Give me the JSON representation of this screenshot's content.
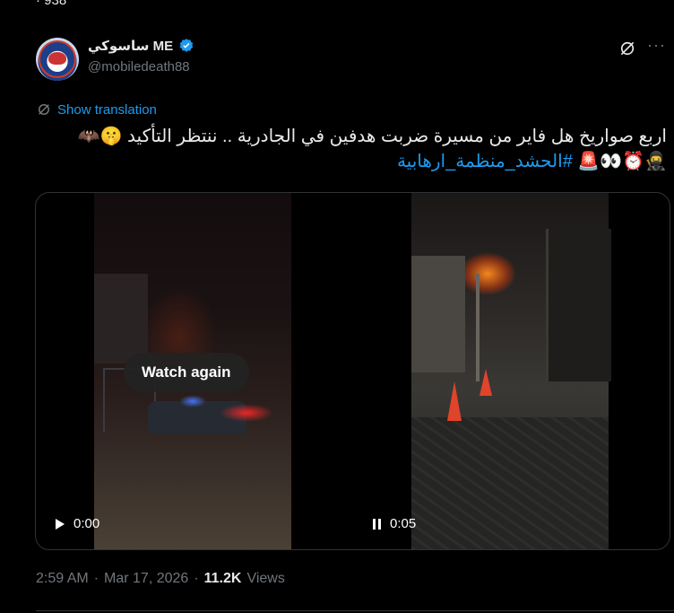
{
  "top_cut_text": "· 938",
  "tweet": {
    "author_name": "ساسوكي ME",
    "author_handle": "@mobiledeath88",
    "show_translation": "Show translation",
    "text_line1": "اربع صواريخ هل فاير من مسيرة ضربت هدفين في الجادرية .. ننتظر التأكيد 🤫🦇",
    "text_line2_emojis": "🥷⏰👀🚨",
    "hashtag": "#الحشد_منظمة_ارهابية",
    "more_label": "···"
  },
  "media": {
    "watch_again_label": "Watch again",
    "video1_time": "0:00",
    "video2_time": "0:05"
  },
  "meta": {
    "time": "2:59 AM",
    "sep1": "·",
    "date": "Mar 17, 2026",
    "sep2": "·",
    "views_count": "11.2K",
    "views_label": "Views"
  },
  "colors": {
    "background": "#000000",
    "text": "#e7e9ea",
    "muted": "#71767b",
    "accent": "#1d9bf0",
    "border": "#2f3336"
  },
  "icons": [
    "verified-badge-icon",
    "grok-icon",
    "more-icon",
    "translate-icon",
    "play-icon",
    "pause-icon"
  ]
}
